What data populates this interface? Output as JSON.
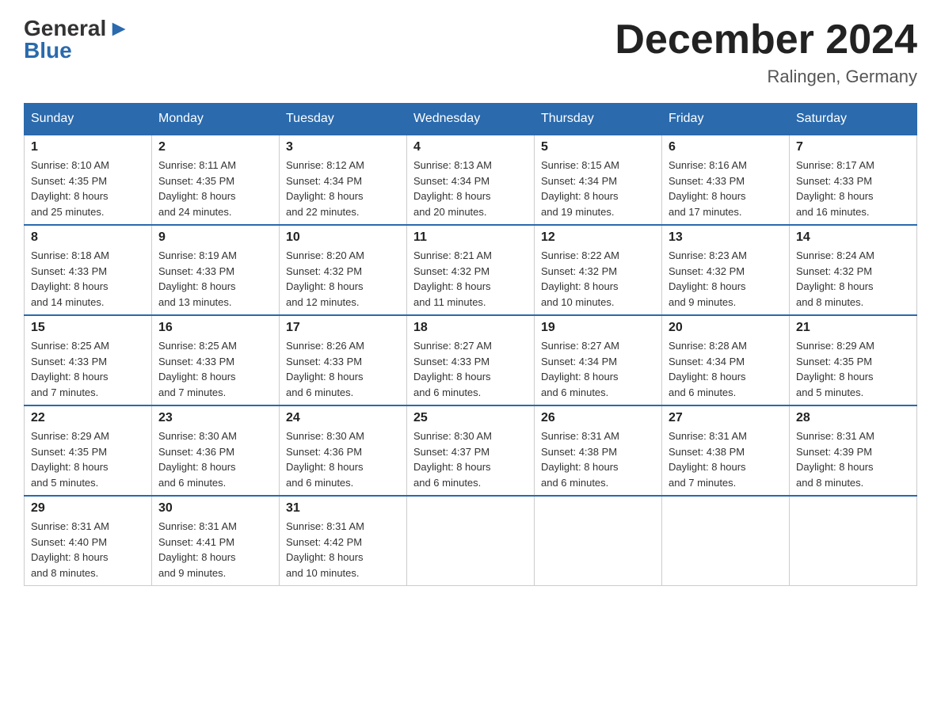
{
  "header": {
    "logo_general": "General",
    "logo_blue": "Blue",
    "month_title": "December 2024",
    "location": "Ralingen, Germany"
  },
  "days_of_week": [
    "Sunday",
    "Monday",
    "Tuesday",
    "Wednesday",
    "Thursday",
    "Friday",
    "Saturday"
  ],
  "weeks": [
    [
      {
        "day": "1",
        "sunrise": "8:10 AM",
        "sunset": "4:35 PM",
        "daylight": "8 hours and 25 minutes."
      },
      {
        "day": "2",
        "sunrise": "8:11 AM",
        "sunset": "4:35 PM",
        "daylight": "8 hours and 24 minutes."
      },
      {
        "day": "3",
        "sunrise": "8:12 AM",
        "sunset": "4:34 PM",
        "daylight": "8 hours and 22 minutes."
      },
      {
        "day": "4",
        "sunrise": "8:13 AM",
        "sunset": "4:34 PM",
        "daylight": "8 hours and 20 minutes."
      },
      {
        "day": "5",
        "sunrise": "8:15 AM",
        "sunset": "4:34 PM",
        "daylight": "8 hours and 19 minutes."
      },
      {
        "day": "6",
        "sunrise": "8:16 AM",
        "sunset": "4:33 PM",
        "daylight": "8 hours and 17 minutes."
      },
      {
        "day": "7",
        "sunrise": "8:17 AM",
        "sunset": "4:33 PM",
        "daylight": "8 hours and 16 minutes."
      }
    ],
    [
      {
        "day": "8",
        "sunrise": "8:18 AM",
        "sunset": "4:33 PM",
        "daylight": "8 hours and 14 minutes."
      },
      {
        "day": "9",
        "sunrise": "8:19 AM",
        "sunset": "4:33 PM",
        "daylight": "8 hours and 13 minutes."
      },
      {
        "day": "10",
        "sunrise": "8:20 AM",
        "sunset": "4:32 PM",
        "daylight": "8 hours and 12 minutes."
      },
      {
        "day": "11",
        "sunrise": "8:21 AM",
        "sunset": "4:32 PM",
        "daylight": "8 hours and 11 minutes."
      },
      {
        "day": "12",
        "sunrise": "8:22 AM",
        "sunset": "4:32 PM",
        "daylight": "8 hours and 10 minutes."
      },
      {
        "day": "13",
        "sunrise": "8:23 AM",
        "sunset": "4:32 PM",
        "daylight": "8 hours and 9 minutes."
      },
      {
        "day": "14",
        "sunrise": "8:24 AM",
        "sunset": "4:32 PM",
        "daylight": "8 hours and 8 minutes."
      }
    ],
    [
      {
        "day": "15",
        "sunrise": "8:25 AM",
        "sunset": "4:33 PM",
        "daylight": "8 hours and 7 minutes."
      },
      {
        "day": "16",
        "sunrise": "8:25 AM",
        "sunset": "4:33 PM",
        "daylight": "8 hours and 7 minutes."
      },
      {
        "day": "17",
        "sunrise": "8:26 AM",
        "sunset": "4:33 PM",
        "daylight": "8 hours and 6 minutes."
      },
      {
        "day": "18",
        "sunrise": "8:27 AM",
        "sunset": "4:33 PM",
        "daylight": "8 hours and 6 minutes."
      },
      {
        "day": "19",
        "sunrise": "8:27 AM",
        "sunset": "4:34 PM",
        "daylight": "8 hours and 6 minutes."
      },
      {
        "day": "20",
        "sunrise": "8:28 AM",
        "sunset": "4:34 PM",
        "daylight": "8 hours and 6 minutes."
      },
      {
        "day": "21",
        "sunrise": "8:29 AM",
        "sunset": "4:35 PM",
        "daylight": "8 hours and 5 minutes."
      }
    ],
    [
      {
        "day": "22",
        "sunrise": "8:29 AM",
        "sunset": "4:35 PM",
        "daylight": "8 hours and 5 minutes."
      },
      {
        "day": "23",
        "sunrise": "8:30 AM",
        "sunset": "4:36 PM",
        "daylight": "8 hours and 6 minutes."
      },
      {
        "day": "24",
        "sunrise": "8:30 AM",
        "sunset": "4:36 PM",
        "daylight": "8 hours and 6 minutes."
      },
      {
        "day": "25",
        "sunrise": "8:30 AM",
        "sunset": "4:37 PM",
        "daylight": "8 hours and 6 minutes."
      },
      {
        "day": "26",
        "sunrise": "8:31 AM",
        "sunset": "4:38 PM",
        "daylight": "8 hours and 6 minutes."
      },
      {
        "day": "27",
        "sunrise": "8:31 AM",
        "sunset": "4:38 PM",
        "daylight": "8 hours and 7 minutes."
      },
      {
        "day": "28",
        "sunrise": "8:31 AM",
        "sunset": "4:39 PM",
        "daylight": "8 hours and 8 minutes."
      }
    ],
    [
      {
        "day": "29",
        "sunrise": "8:31 AM",
        "sunset": "4:40 PM",
        "daylight": "8 hours and 8 minutes."
      },
      {
        "day": "30",
        "sunrise": "8:31 AM",
        "sunset": "4:41 PM",
        "daylight": "8 hours and 9 minutes."
      },
      {
        "day": "31",
        "sunrise": "8:31 AM",
        "sunset": "4:42 PM",
        "daylight": "8 hours and 10 minutes."
      },
      null,
      null,
      null,
      null
    ]
  ],
  "labels": {
    "sunrise": "Sunrise:",
    "sunset": "Sunset:",
    "daylight": "Daylight:"
  }
}
